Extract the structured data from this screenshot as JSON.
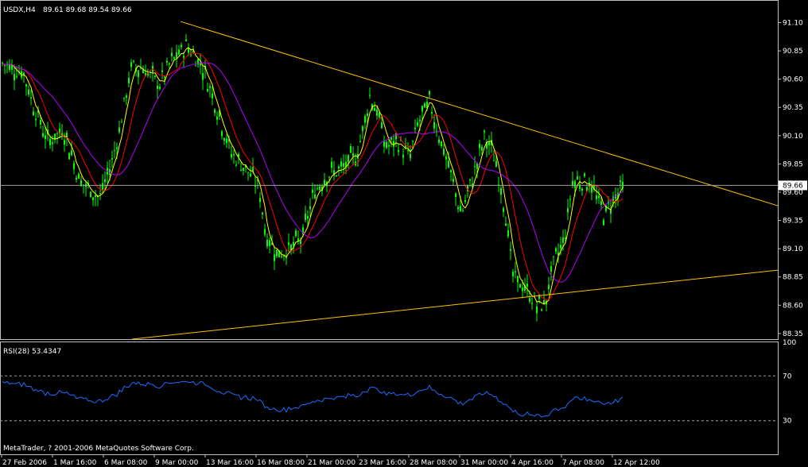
{
  "chart_data": [
    {
      "type": "candlestick",
      "symbol_label": "USDX,H4",
      "ohlc_label": "89.61 89.68 89.54 89.66",
      "y_ticks": [
        "91.10",
        "90.85",
        "90.60",
        "90.35",
        "90.10",
        "89.85",
        "89.60",
        "89.35",
        "89.10",
        "88.85",
        "88.60",
        "88.35"
      ],
      "ylim": [
        88.3,
        91.3
      ],
      "current_price": "89.66",
      "colors": {
        "bull": "#00ff00",
        "bear": "#00ff00",
        "ma_fast": "#ffff00",
        "ma_mid": "#ff0000",
        "ma_slow": "#b400ff",
        "trendline": "#ffc000",
        "price_line": "#a0a0a0"
      },
      "trendlines": [
        {
          "name": "upper",
          "from": [
            0.232,
            91.11
          ],
          "to": [
            1.0,
            89.48
          ]
        },
        {
          "name": "lower",
          "from": [
            0.17,
            88.3
          ],
          "to": [
            1.0,
            88.91
          ]
        }
      ]
    },
    {
      "type": "line",
      "label": "RSI(28) 53.4347",
      "y_ticks": [
        "100",
        "70",
        "30"
      ],
      "ylim": [
        0,
        100
      ],
      "levels": [
        70,
        30
      ],
      "color": "#1e6bff"
    }
  ],
  "x_ticks": [
    "27 Feb 2006",
    "1 Mar 16:00",
    "6 Mar 08:00",
    "9 Mar 00:00",
    "13 Mar 16:00",
    "16 Mar 08:00",
    "21 Mar 00:00",
    "23 Mar 16:00",
    "28 Mar 08:00",
    "31 Mar 00:00",
    "4 Apr 16:00",
    "7 Apr 08:00",
    "12 Apr 12:00"
  ],
  "copyright": "MetaTrader, ? 2001-2006 MetaQuotes Software Corp."
}
